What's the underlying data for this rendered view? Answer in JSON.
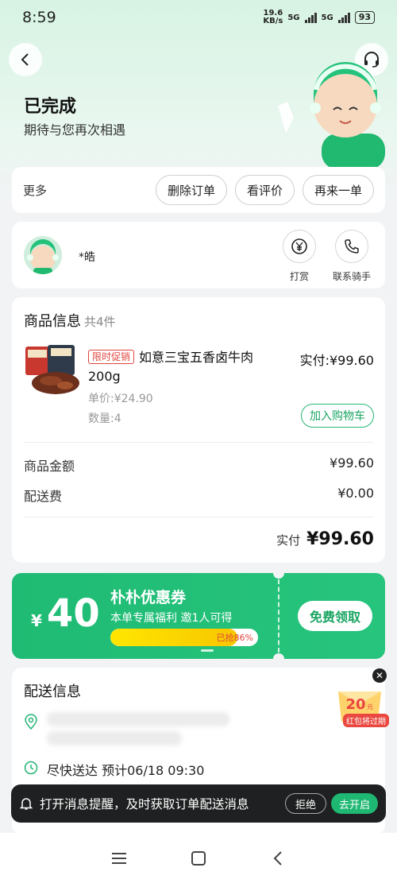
{
  "status_bar": {
    "time": "8:59",
    "net_speed_value": "19.6",
    "net_speed_unit": "KB/s",
    "net1": "5G",
    "net2": "5G",
    "battery": "93"
  },
  "header": {
    "title": "已完成",
    "subtitle": "期待与您再次相遇"
  },
  "more_bar": {
    "label": "更多",
    "buttons": [
      "删除订单",
      "看评价",
      "再来一单"
    ]
  },
  "rider": {
    "name": "*皓",
    "tip_label": "打赏",
    "contact_label": "联系骑手"
  },
  "goods": {
    "title": "商品信息",
    "count": "共4件",
    "item": {
      "promo_tag": "限时促销",
      "name": "如意三宝五香卤牛肉200g",
      "pay": "实付:¥99.60",
      "unit_price": "单价:¥24.90",
      "quantity": "数量:4",
      "add_cart": "加入购物车"
    },
    "amount_label": "商品金额",
    "amount_value": "¥99.60",
    "delivery_fee_label": "配送费",
    "delivery_fee_value": "¥0.00",
    "total_label": "实付",
    "total_value": "¥99.60"
  },
  "coupon": {
    "currency": "¥",
    "amount": "40",
    "title": "朴朴优惠券",
    "desc": "本单专属福利 邀1人可得",
    "progress_text": "已抢86%",
    "progress_fraction": 0.86,
    "button": "免费领取",
    "color": "#22bf78"
  },
  "delivery": {
    "title": "配送信息",
    "time_text": "尽快送达 预计06/18 09:30"
  },
  "red_packet": {
    "amount": "20",
    "unit": "元",
    "label": "红包将过期"
  },
  "toast": {
    "text": "打开消息提醒，及时获取订单配送消息",
    "reject": "拒绝",
    "open": "去开启"
  },
  "colors": {
    "brand_green": "#1fb873",
    "promo_red": "#e0453e"
  }
}
